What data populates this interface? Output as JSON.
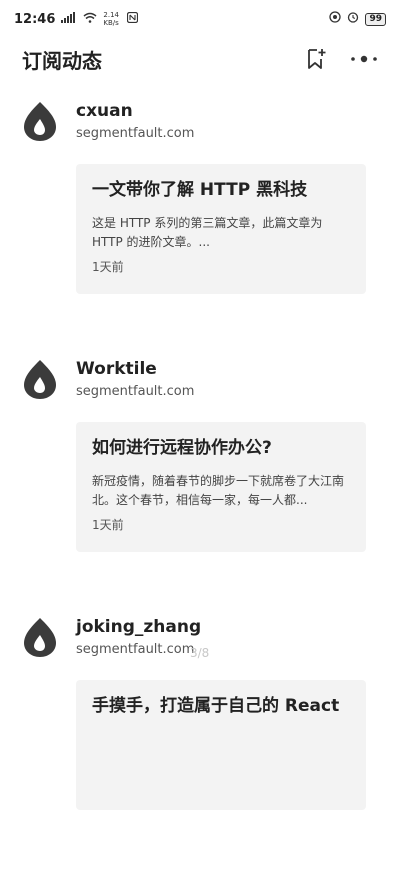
{
  "status_bar": {
    "time": "12:46",
    "net_speed": "2.14 KB/s",
    "battery": "99"
  },
  "header": {
    "title": "订阅动态"
  },
  "feed": [
    {
      "author": "cxuan",
      "source": "segmentfault.com",
      "title": "一文带你了解 HTTP 黑科技",
      "summary": "这是 HTTP 系列的第三篇文章，此篇文章为 HTTP 的进阶文章。...",
      "time": "1天前"
    },
    {
      "author": "Worktile",
      "source": "segmentfault.com",
      "title": "如何进行远程协作办公?",
      "summary": "新冠疫情，随着春节的脚步一下就席卷了大江南北。这个春节，相信每一家，每一人都...",
      "time": "1天前"
    },
    {
      "author": "joking_zhang",
      "source": "segmentfault.com",
      "title": "手摸手，打造属于自己的 React",
      "summary": "",
      "time": ""
    }
  ],
  "page_indicator": "3/8",
  "colors": {
    "card_background": "#f3f3f3",
    "avatar": "#3b3b3b"
  },
  "icons": {
    "avatar": "flame-icon",
    "add_bookmark": "bookmark-add-icon",
    "more": "more-dots-icon"
  }
}
